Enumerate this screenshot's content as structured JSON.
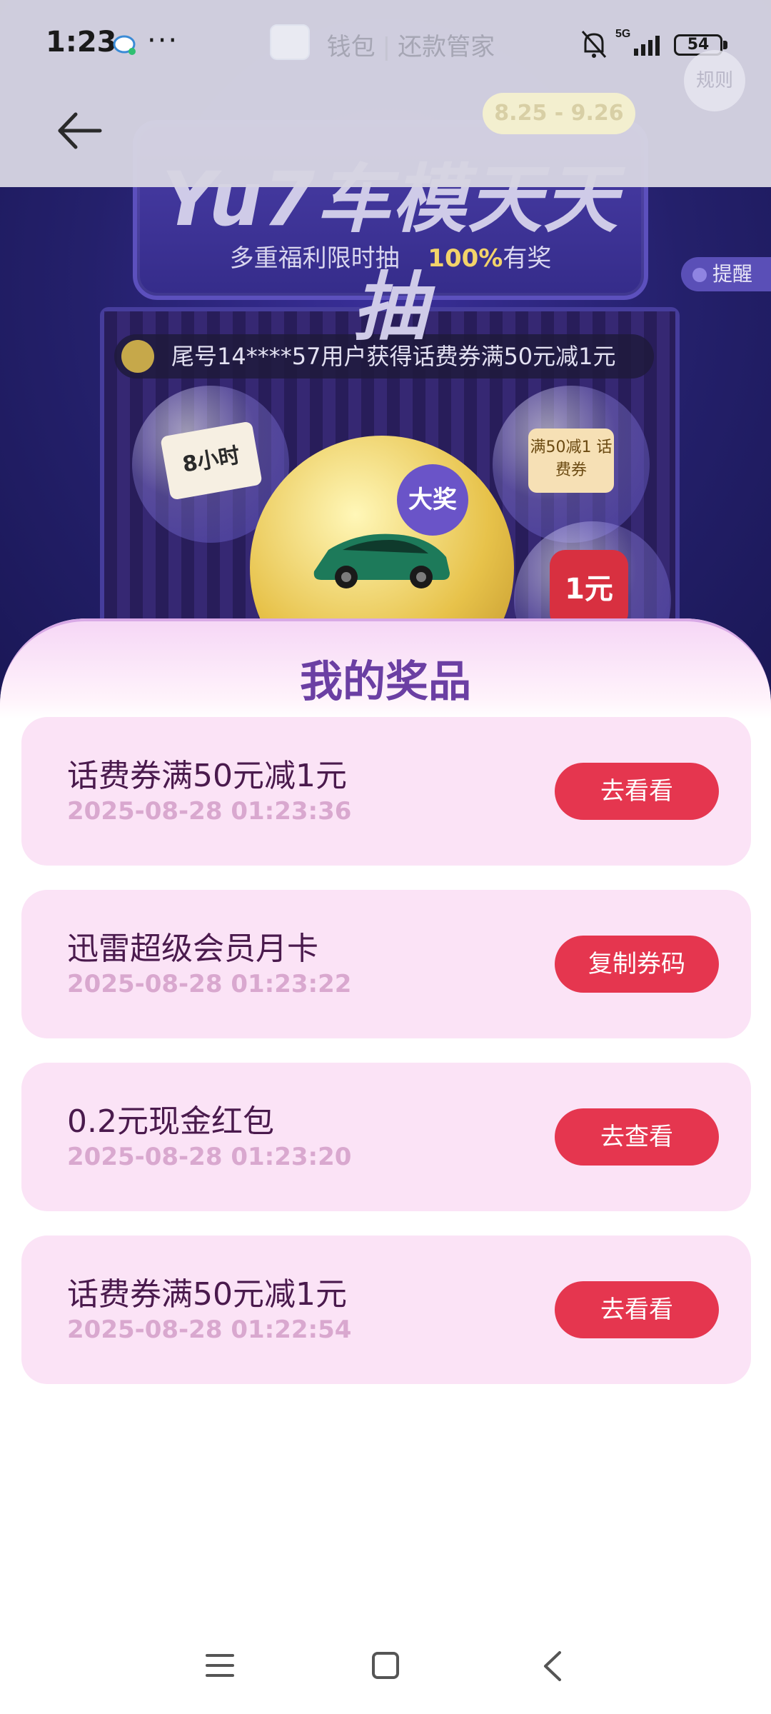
{
  "status_bar": {
    "time": "1:23",
    "network": "5G",
    "battery": "54",
    "app_title": "钱包",
    "app_subtitle": "还款管家"
  },
  "hero": {
    "rules_label": "规则",
    "date_range": "8.25 - 9.26",
    "title": "Yu7车模天天抽",
    "subtitle_prefix": "多重福利限时抽",
    "subtitle_pct": "100%",
    "subtitle_suffix": "有奖",
    "remind_label": "提醒",
    "ticker_text": "尾号14****57用户获得话费券满50元减1元",
    "grand_prize_label": "大奖",
    "capsule_hours": "8小时",
    "capsule_coupon": "满50减1 话费券",
    "capsule_yuan": "1元"
  },
  "panel": {
    "title": "我的奖品",
    "prizes": [
      {
        "name": "话费券满50元减1元",
        "time": "2025-08-28 01:23:36",
        "button": "去看看"
      },
      {
        "name": "迅雷超级会员月卡",
        "time": "2025-08-28 01:23:22",
        "button": "复制券码"
      },
      {
        "name": "0.2元现金红包",
        "time": "2025-08-28 01:23:20",
        "button": "去查看"
      },
      {
        "name": "话费券满50元减1元",
        "time": "2025-08-28 01:22:54",
        "button": "去看看"
      }
    ]
  },
  "colors": {
    "accent_button": "#e5364f",
    "card_bg": "#fbe3f6",
    "panel_title": "#6b3fa3"
  }
}
